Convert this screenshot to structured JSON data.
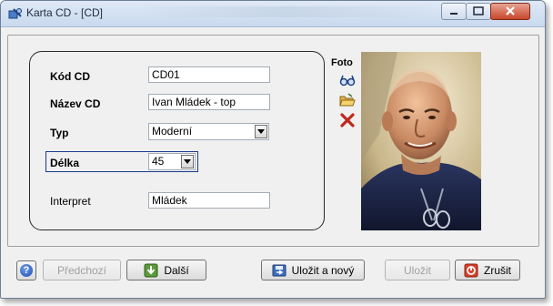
{
  "window": {
    "title": "Karta CD - [CD]"
  },
  "form": {
    "kod_label": "Kód CD",
    "kod_value": "CD01",
    "nazev_label": "Název CD",
    "nazev_value": "Ivan Mládek - top",
    "typ_label": "Typ",
    "typ_value": "Moderní",
    "delka_label": "Délka",
    "delka_value": "45",
    "interpret_label": "Interpret",
    "interpret_value": "Mládek"
  },
  "foto": {
    "label": "Foto",
    "tools": [
      "view-glasses-icon",
      "open-folder-icon",
      "delete-x-icon"
    ]
  },
  "buttons": {
    "help": "?",
    "predchozi": "Předchozí",
    "dalsi": "Další",
    "ulozit_a_novy": "Uložit a nový",
    "ulozit": "Uložit",
    "zrusit": "Zrušit"
  },
  "colors": {
    "window_bg": "#f0f0f0",
    "focus_border": "#1d3a8f",
    "close_red": "#c8472c",
    "delete_red": "#c0281c"
  }
}
